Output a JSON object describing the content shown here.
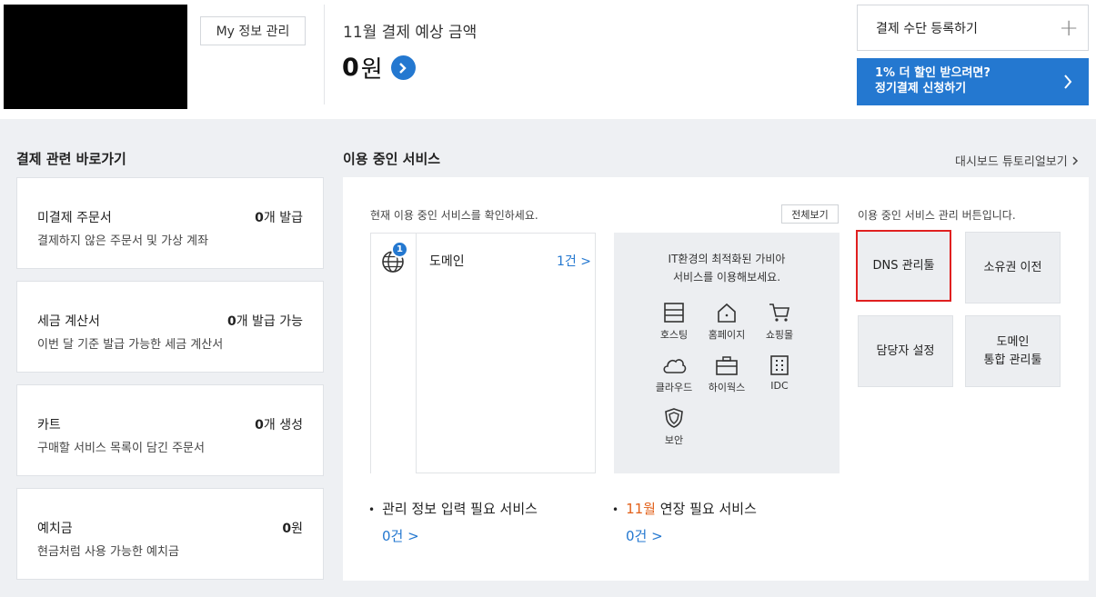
{
  "header": {
    "my_info_label": "My 정보 관리",
    "bill_label": "11월 결제 예상 금액",
    "bill_amount": "0",
    "bill_unit": "원",
    "pay_register_label": "결제 수단 등록하기",
    "discount_line1": "1% 더 할인 받으려면?",
    "discount_line2": "정기결제 신청하기"
  },
  "shortcuts": {
    "title": "결제 관련 바로가기",
    "cards": [
      {
        "title": "미결제 주문서",
        "count": "0",
        "suffix": "개 발급",
        "desc": "결제하지 않은 주문서 및 가상 계좌"
      },
      {
        "title": "세금 계산서",
        "count": "0",
        "suffix": "개 발급 가능",
        "desc": "이번 달 기준 발급 가능한 세금 계산서"
      },
      {
        "title": "카트",
        "count": "0",
        "suffix": "개 생성",
        "desc": "구매할 서비스 목록이 담긴 주문서"
      },
      {
        "title": "예치금",
        "count": "0",
        "suffix": "원",
        "desc": "현금처럼 사용 가능한 예치금"
      }
    ]
  },
  "services": {
    "title": "이용 중인 서비스",
    "tutorial_link": "대시보드 튜토리얼보기",
    "hint": "현재 이용 중인 서비스를 확인하세요.",
    "view_all": "전체보기",
    "items": [
      {
        "badge": "1",
        "name": "도메인",
        "count": "1건 >",
        "icon": "globe-icon"
      }
    ],
    "promo_line1": "IT환경의 최적화된 가비아",
    "promo_line2": "서비스를 이용해보세요.",
    "promo_items": [
      {
        "label": "호스팅",
        "icon": "hosting-icon"
      },
      {
        "label": "홈페이지",
        "icon": "home-icon"
      },
      {
        "label": "쇼핑몰",
        "icon": "cart-icon"
      },
      {
        "label": "클라우드",
        "icon": "cloud-icon"
      },
      {
        "label": "하이웍스",
        "icon": "briefcase-icon"
      },
      {
        "label": "IDC",
        "icon": "building-icon"
      },
      {
        "label": "보안",
        "icon": "shield-icon"
      }
    ],
    "manage_hint": "이용 중인 서비스 관리 버튼입니다.",
    "manage_buttons": [
      "DNS 관리툴",
      "소유권 이전",
      "담당자 설정",
      "도메인\n통합 관리툴"
    ],
    "bottom": {
      "info_label": "관리 정보 입력 필요 서비스",
      "info_count": "0건 >",
      "renew_month": "11월",
      "renew_label": " 연장 필요 서비스",
      "renew_count": "0건 >"
    }
  },
  "colors": {
    "accent": "#2478d0",
    "highlight": "#e02020",
    "month": "#e2611b"
  }
}
